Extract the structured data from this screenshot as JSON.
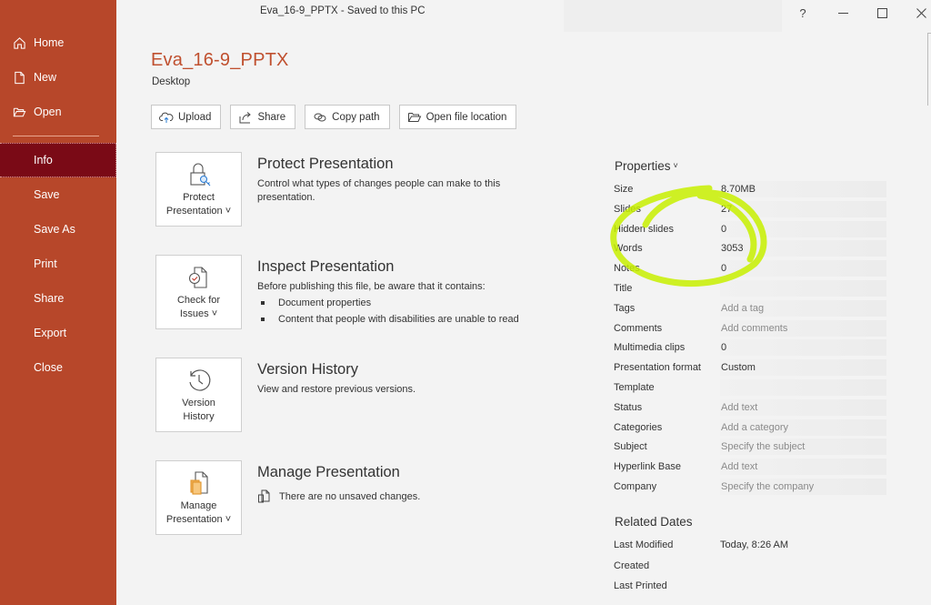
{
  "window": {
    "title": "Eva_16-9_PPTX  -  Saved to this PC",
    "controls": {
      "help": "?",
      "minimize": "—",
      "maximize": "☐",
      "close": "✕"
    }
  },
  "sidebar": {
    "items": [
      {
        "label": "Home",
        "icon": "home-icon"
      },
      {
        "label": "New",
        "icon": "new-document-icon"
      },
      {
        "label": "Open",
        "icon": "folder-open-icon"
      },
      {
        "label": "Info",
        "active": true
      },
      {
        "label": "Save"
      },
      {
        "label": "Save As"
      },
      {
        "label": "Print"
      },
      {
        "label": "Share"
      },
      {
        "label": "Export"
      },
      {
        "label": "Close"
      }
    ]
  },
  "header": {
    "title": "Eva_16-9_PPTX",
    "location": "Desktop",
    "actions": [
      {
        "label": "Upload",
        "icon": "cloud-upload-icon"
      },
      {
        "label": "Share",
        "icon": "share-icon"
      },
      {
        "label": "Copy path",
        "icon": "link-icon"
      },
      {
        "label": "Open file location",
        "icon": "folder-open-icon"
      }
    ]
  },
  "sections": {
    "protect": {
      "button_line1": "Protect",
      "button_line2": "Presentation ˅",
      "title": "Protect Presentation",
      "description": "Control what types of changes people can make to this presentation."
    },
    "inspect": {
      "button_line1": "Check for",
      "button_line2": "Issues ˅",
      "title": "Inspect Presentation",
      "description": "Before publishing this file, be aware that it contains:",
      "bullets": [
        "Document properties",
        "Content that people with disabilities are unable to read"
      ]
    },
    "version": {
      "button_line1": "Version",
      "button_line2": "History",
      "title": "Version History",
      "description": "View and restore previous versions."
    },
    "manage": {
      "button_line1": "Manage",
      "button_line2": "Presentation ˅",
      "title": "Manage Presentation",
      "description": "There are no unsaved changes."
    }
  },
  "properties": {
    "heading": "Properties",
    "heading_chevron": "˅",
    "rows": [
      {
        "key": "Size",
        "value": "8.70MB"
      },
      {
        "key": "Slides",
        "value": "27"
      },
      {
        "key": "Hidden slides",
        "value": "0"
      },
      {
        "key": "Words",
        "value": "3053"
      },
      {
        "key": "Notes",
        "value": "0"
      },
      {
        "key": "Title",
        "value": ""
      },
      {
        "key": "Tags",
        "value": "Add a tag",
        "placeholder": true
      },
      {
        "key": "Comments",
        "value": "Add comments",
        "placeholder": true
      },
      {
        "key": "Multimedia clips",
        "value": "0"
      },
      {
        "key": "Presentation format",
        "value": "Custom"
      },
      {
        "key": "Template",
        "value": ""
      },
      {
        "key": "Status",
        "value": "Add text",
        "placeholder": true
      },
      {
        "key": "Categories",
        "value": "Add a category",
        "placeholder": true
      },
      {
        "key": "Subject",
        "value": "Specify the subject",
        "placeholder": true
      },
      {
        "key": "Hyperlink Base",
        "value": "Add text",
        "placeholder": true
      },
      {
        "key": "Company",
        "value": "Specify the company",
        "placeholder": true
      }
    ]
  },
  "related_dates": {
    "heading": "Related Dates",
    "rows": [
      {
        "key": "Last Modified",
        "value": "Today, 8:26 AM"
      },
      {
        "key": "Created",
        "value": ""
      },
      {
        "key": "Last Printed",
        "value": ""
      }
    ]
  },
  "colors": {
    "sidebar": "#b7472a",
    "sidebar_active": "#7a0a16",
    "title_accent": "#c0502f",
    "highlighter": "#c8f000"
  }
}
